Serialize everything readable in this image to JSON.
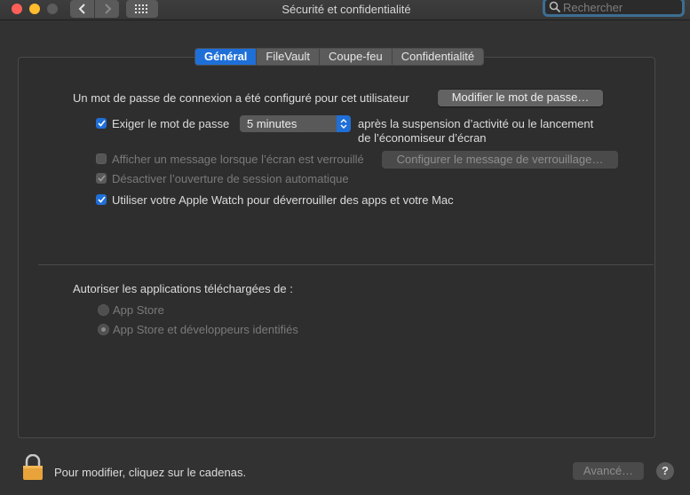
{
  "window": {
    "title": "Sécurité et confidentialité"
  },
  "search": {
    "placeholder": "Rechercher"
  },
  "tabs": [
    {
      "label": "Général",
      "active": true
    },
    {
      "label": "FileVault",
      "active": false
    },
    {
      "label": "Coupe-feu",
      "active": false
    },
    {
      "label": "Confidentialité",
      "active": false
    }
  ],
  "general": {
    "password_text": "Un mot de passe de connexion a été configuré pour cet utilisateur",
    "change_password_button": "Modifier le mot de passe…",
    "require_password": {
      "label": "Exiger le mot de passe",
      "checked": true,
      "delay_value": "5 minutes",
      "after_text_1": "après la suspension d’activité ou le lancement",
      "after_text_2": "de l’économiseur d’écran"
    },
    "show_message": {
      "label": "Afficher un message lorsque l’écran est verrouillé",
      "checked": false,
      "button": "Configurer le message de verrouillage…"
    },
    "disable_auto_login": {
      "label": "Désactiver l’ouverture de session automatique",
      "checked": true
    },
    "apple_watch": {
      "label": "Utiliser votre Apple Watch pour déverrouiller des apps et votre Mac",
      "checked": true
    }
  },
  "downloads": {
    "heading": "Autoriser les applications téléchargées de :",
    "options": [
      {
        "label": "App Store",
        "selected": false
      },
      {
        "label": "App Store et développeurs identifiés",
        "selected": true
      }
    ]
  },
  "footer": {
    "lock_text": "Pour modifier, cliquez sur le cadenas.",
    "advanced_button": "Avancé…",
    "help_label": "?"
  },
  "colors": {
    "accent": "#1f6fd8",
    "lock": "#e8a33a",
    "search_ring": "#3d6e92"
  }
}
